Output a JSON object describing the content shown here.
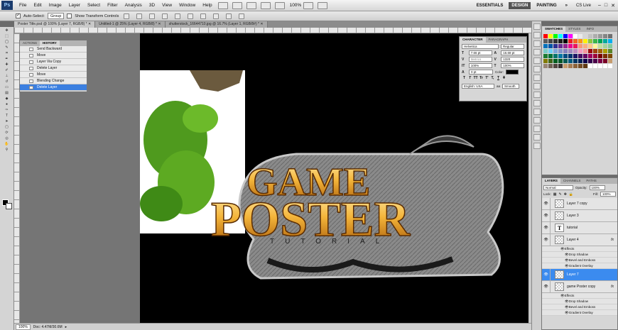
{
  "menubar": {
    "logo": "Ps",
    "items": [
      "File",
      "Edit",
      "Image",
      "Layer",
      "Select",
      "Filter",
      "Analysis",
      "3D",
      "View",
      "Window",
      "Help"
    ],
    "zoom": "100%",
    "workspaces": [
      "ESSENTIALS",
      "DESIGN",
      "PAINTING"
    ],
    "active_workspace": "DESIGN",
    "cslive": "CS Live"
  },
  "options": {
    "auto_select_label": "Auto-Select:",
    "auto_select_value": "Group",
    "transform_label": "Show Transform Controls"
  },
  "tabs": [
    {
      "label": "Poster Title.psd @ 100% (Layer 7, RGB/8) *",
      "active": true
    },
    {
      "label": "Untitled-1 @ 25% (Layer 4, RGB/8) *",
      "active": false
    },
    {
      "label": "shutterstock_16644710.jpg @ 16.7% (Layer 1, RGB/8#) *",
      "active": false
    }
  ],
  "history": {
    "tabs": [
      "ACTIONS",
      "HISTORY"
    ],
    "active_tab": "HISTORY",
    "items": [
      "Send Backward",
      "Move",
      "Layer Via Copy",
      "Delete Layer",
      "Move",
      "Blending Change",
      "Delete Layer"
    ],
    "selected_index": 6
  },
  "character": {
    "tabs": [
      "CHARACTER",
      "PARAGRAPH"
    ],
    "font_family": "Helvetica",
    "font_style": "Regular",
    "size": "7.66 pt",
    "leading": "16.68 pt",
    "kerning": "Metrics",
    "tracking": "1320",
    "vscale": "100%",
    "hscale": "100%",
    "baseline": "0 pt",
    "color_label": "Color:",
    "style_buttons": [
      "T",
      "T",
      "TT",
      "Tr",
      "T'",
      "T,",
      "T",
      "T"
    ],
    "language": "English: USA",
    "antialias_label": "aa",
    "antialias": "Smooth"
  },
  "swatches": {
    "tabs": [
      "SWATCHES",
      "STYLES",
      "INFO"
    ],
    "active_tab": "SWATCHES"
  },
  "layers": {
    "tabs": [
      "LAYERS",
      "CHANNELS",
      "PATHS"
    ],
    "active_tab": "LAYERS",
    "blend_mode": "Normal",
    "opacity_label": "Opacity:",
    "opacity": "100%",
    "lock_label": "Lock:",
    "fill_label": "Fill:",
    "fill": "100%",
    "rows": [
      {
        "kind": "layer",
        "name": "Layer 7 copy",
        "thumb": "checker",
        "fx": false,
        "selected": false
      },
      {
        "kind": "layer",
        "name": "Layer 3",
        "thumb": "checker",
        "fx": false,
        "selected": false
      },
      {
        "kind": "layer",
        "name": "tutorial",
        "thumb": "text",
        "fx": false,
        "selected": false
      },
      {
        "kind": "layer",
        "name": "Layer 4",
        "thumb": "checker",
        "fx": true,
        "selected": false
      },
      {
        "kind": "effects",
        "name": "Effects"
      },
      {
        "kind": "effect",
        "name": "Drop Shadow"
      },
      {
        "kind": "effect",
        "name": "Bevel and Emboss"
      },
      {
        "kind": "effect",
        "name": "Gradient Overlay"
      },
      {
        "kind": "layer",
        "name": "Layer 7",
        "thumb": "checker",
        "fx": false,
        "selected": true
      },
      {
        "kind": "layer",
        "name": "game Poster copy",
        "thumb": "checker",
        "fx": true,
        "selected": false
      },
      {
        "kind": "effects",
        "name": "Effects"
      },
      {
        "kind": "effect",
        "name": "Drop Shadow"
      },
      {
        "kind": "effect",
        "name": "Bevel and Emboss"
      },
      {
        "kind": "effect",
        "name": "Gradient Overlay"
      }
    ],
    "fx_label": "fx"
  },
  "artwork": {
    "line1": "GAME",
    "line2": "POSTER",
    "line3": "TUTORIAL"
  },
  "status": {
    "zoom": "100%",
    "doc": "Doc: 4.47M/30.6M"
  },
  "colors": {
    "selection": "#3b8bef",
    "gold_light": "#ffd36b",
    "gold_dark": "#b5650b",
    "moss": "#4f9a1e"
  }
}
